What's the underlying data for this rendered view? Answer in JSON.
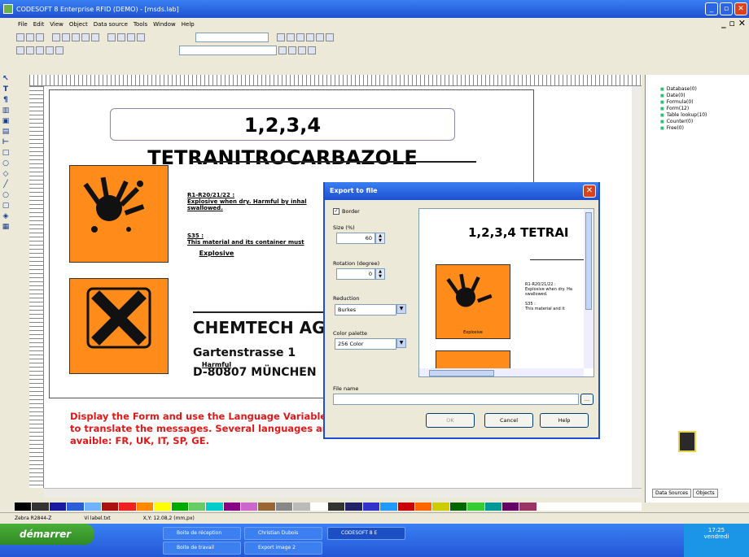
{
  "window": {
    "title": "CODESOFT 8 Enterprise RFID (DEMO) - [msds.lab]"
  },
  "menu": [
    "File",
    "Edit",
    "View",
    "Object",
    "Data source",
    "Tools",
    "Window",
    "Help"
  ],
  "document": {
    "title": "1,2,3,4 TETRANITROCARBAZOLE",
    "pictograms": [
      {
        "label": "Explosive"
      },
      {
        "label": "Harmful"
      }
    ],
    "r_phrase_ref": "R1-R20/21/22 :",
    "r_phrase_text": "Explosive when dry. Harmful by inhal",
    "r_phrase_text2": "swallowed.",
    "s_phrase_ref": "S35 :",
    "s_phrase_text": "This material and its container must",
    "company": {
      "name": "CHEMTECH AG",
      "street": "Gartenstrasse 1",
      "city": "D-80807 MÜNCHEN"
    },
    "message": "Display the Form and use the Language Variable to translate the messages. Several languages are avaible: FR, UK, IT, SP, GE."
  },
  "right_panel": {
    "tree": [
      "Database(0)",
      "Date(0)",
      "Formula(0)",
      "Form(12)",
      "Table lookup(10)",
      "Counter(0)",
      "Free(0)"
    ],
    "tabs": [
      "Data Sources",
      "Objects"
    ]
  },
  "dialog": {
    "title": "Export to file",
    "border_label": "Border",
    "border_checked": true,
    "size_label": "Size (%)",
    "size_value": "60",
    "rotation_label": "Rotation (degree)",
    "rotation_value": "0",
    "reduction_label": "Reduction",
    "reduction_value": "Burkes",
    "palette_label": "Color palette",
    "palette_value": "256 Color",
    "filename_label": "File name",
    "filename_value": "",
    "ok_label": "OK",
    "cancel_label": "Cancel",
    "help_label": "Help",
    "preview": {
      "title": "1,2,3,4 TETRAI",
      "r_ref": "R1-R20/21/22 :",
      "r_text": "Explosive when dry. Ha",
      "r_text2": "swallowed.",
      "s_ref": "S35 :",
      "s_text": "This material and it",
      "picto_label": "Explosive"
    }
  },
  "status": [
    "Zebra R2844-Z",
    "Vi label.txt",
    "X,Y: 12.08,2 (mm,px)"
  ],
  "taskbar": {
    "start": "démarrer",
    "tasks": [
      "Boite de réception",
      "Christian Dubois",
      "CODESOFT 8 E",
      "Boite de travail",
      "Export image 2"
    ],
    "tray_time": "17:25",
    "tray_day": "vendredi"
  }
}
